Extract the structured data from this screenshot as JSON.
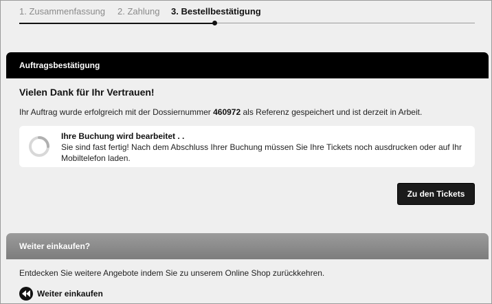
{
  "steps": [
    {
      "label": "1. Zusammenfassung",
      "state": "done"
    },
    {
      "label": "2. Zahlung",
      "state": "done"
    },
    {
      "label": "3. Bestellbestätigung",
      "state": "active"
    }
  ],
  "confirmation": {
    "header": "Auftragsbestätigung",
    "thanks": "Vielen Dank für Ihr Vertrauen!",
    "order_text_before": "Ihr Auftrag wurde erfolgreich mit der Dossiernummer ",
    "dossier_number": "460972",
    "order_text_after": " als Referenz gespeichert und ist derzeit in Arbeit.",
    "status_title": "Ihre Buchung wird bearbeitet . .",
    "status_body": "Sie sind fast fertig! Nach dem Abschluss Ihrer Buchung müssen Sie Ihre Tickets noch ausdrucken oder auf Ihr Mobiltelefon laden.",
    "tickets_button": "Zu den Tickets"
  },
  "shop": {
    "header": "Weiter einkaufen?",
    "text": "Entdecken Sie weitere Angebote indem Sie zu unserem Online Shop zurückkehren.",
    "link": "Weiter einkaufen",
    "link_icon": "rewind-icon"
  },
  "colors": {
    "header_dark": "#000000",
    "header_gray": "#8a8a8a",
    "background": "#efefef",
    "button": "#1b1b1b"
  }
}
